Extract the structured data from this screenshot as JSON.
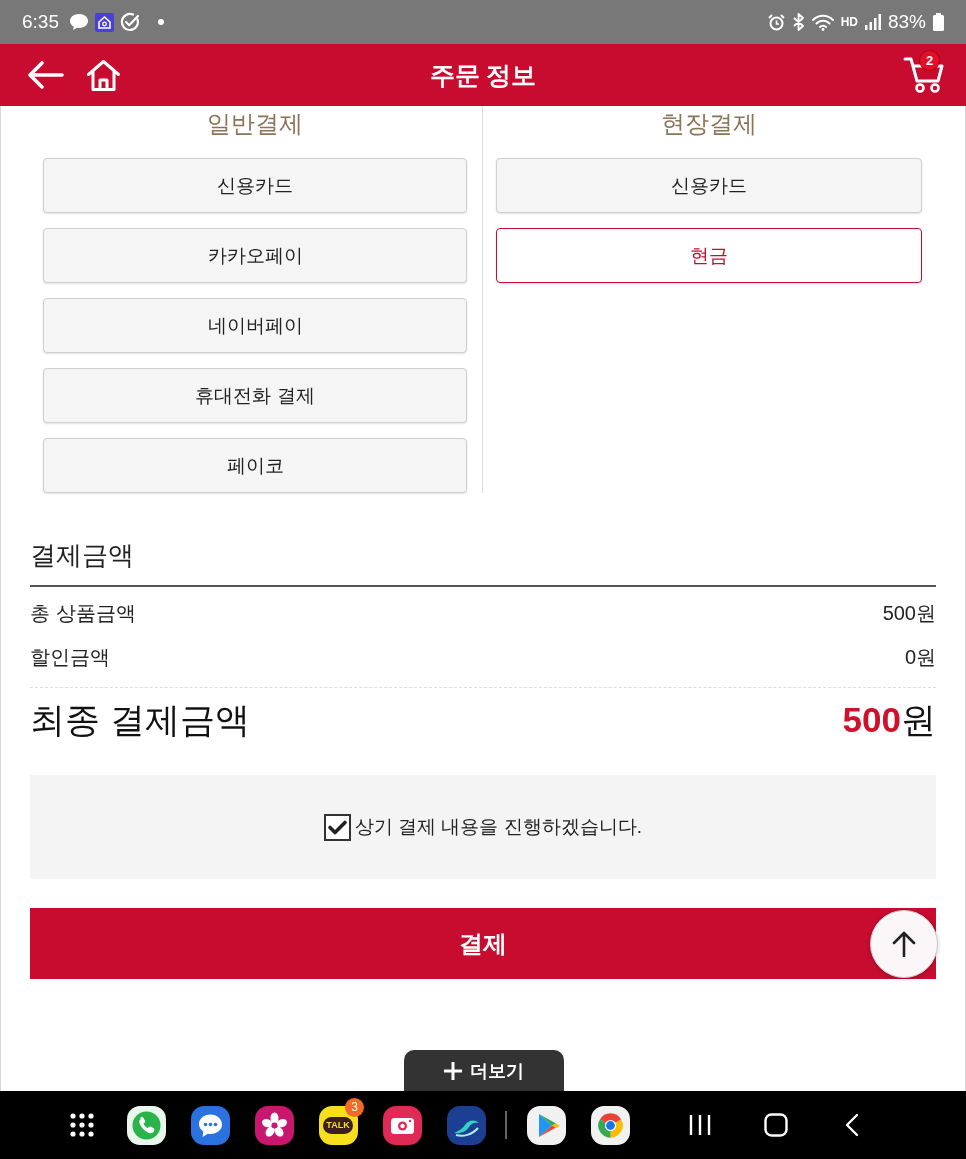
{
  "status_bar": {
    "time": "6:35",
    "hd_label": "HD",
    "battery": "83%"
  },
  "header": {
    "title": "주문 정보",
    "cart_count": "2"
  },
  "payment_methods": {
    "columns": [
      {
        "heading": "일반결제",
        "options": [
          {
            "label": "신용카드",
            "selected": false
          },
          {
            "label": "카카오페이",
            "selected": false
          },
          {
            "label": "네이버페이",
            "selected": false
          },
          {
            "label": "휴대전화 결제",
            "selected": false
          },
          {
            "label": "페이코",
            "selected": false
          }
        ]
      },
      {
        "heading": "현장결제",
        "options": [
          {
            "label": "신용카드",
            "selected": false
          },
          {
            "label": "현금",
            "selected": true
          }
        ]
      }
    ]
  },
  "payment_amount": {
    "title": "결제금액",
    "rows": [
      {
        "label": "총 상품금액",
        "value": "500원"
      },
      {
        "label": "할인금액",
        "value": "0원"
      }
    ],
    "final": {
      "label": "최종 결제금액",
      "value": "**500**원"
    }
  },
  "agreement": {
    "checked": true,
    "label": "상기 결제 내용을 진행하겠습니다."
  },
  "pay_button": {
    "label": "결제"
  },
  "more_button": {
    "label": "더보기"
  },
  "taskbar": {
    "talk_label": "TALK",
    "talk_badge": "3"
  }
}
